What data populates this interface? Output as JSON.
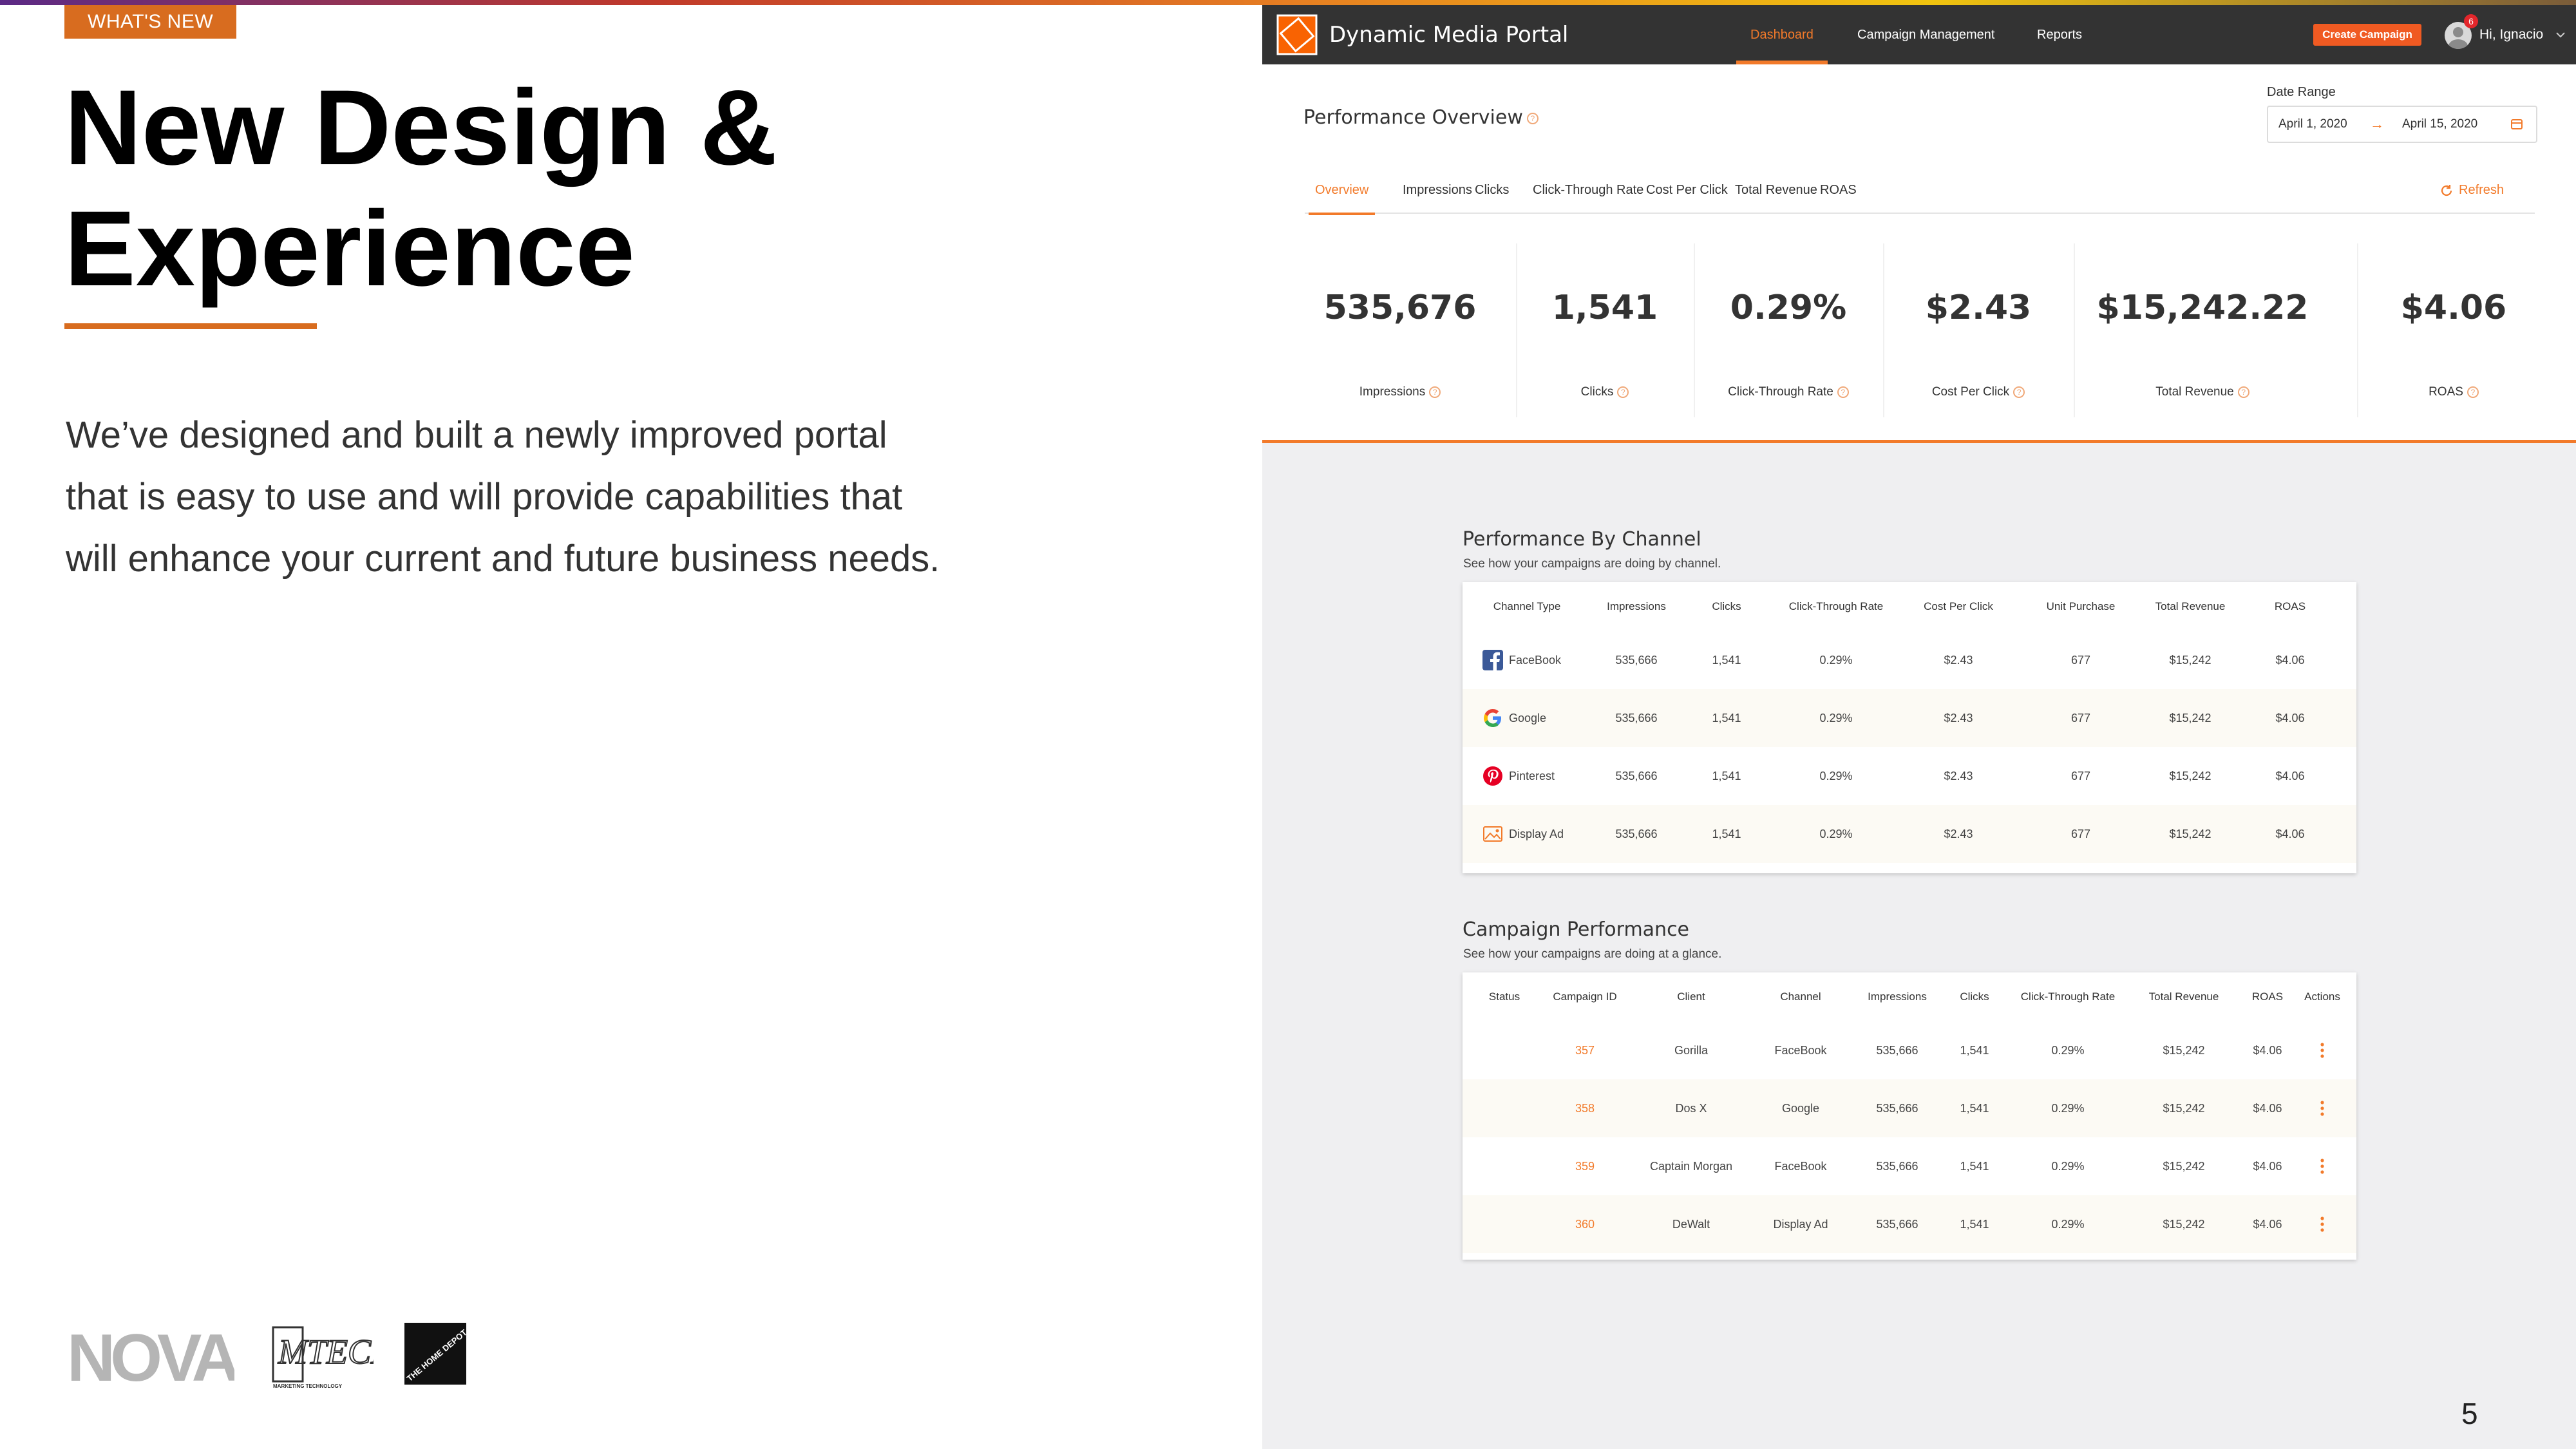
{
  "slide": {
    "tag": "WHAT'S NEW",
    "title_line1": "New Design &",
    "title_line2": "Experience",
    "body_line1": "We’ve designed and built a newly improved portal",
    "body_line2": "that is easy to use and will provide capabilities that",
    "body_line3": "will enhance your current and future business needs.",
    "page_number": "5"
  },
  "navbar": {
    "app_title": "Dynamic Media Portal",
    "links": [
      "Dashboard",
      "Campaign Management",
      "Reports"
    ],
    "active_link": "Dashboard",
    "create_label": "Create Campaign",
    "notification_count": "6",
    "greeting": "Hi, Ignacio"
  },
  "overview": {
    "title": "Performance Overview",
    "date_label": "Date Range",
    "date_start": "April 1, 2020",
    "date_arrow": "→",
    "date_end": "April 15, 2020",
    "tabs": [
      "Overview",
      "Impressions",
      "Clicks",
      "Click-Through Rate",
      "Cost Per Click",
      "Total Revenue",
      "ROAS"
    ],
    "refresh_label": "Refresh",
    "metrics": [
      {
        "value": "535,676",
        "label": "Impressions"
      },
      {
        "value": "1,541",
        "label": "Clicks"
      },
      {
        "value": "0.29%",
        "label": "Click-Through Rate"
      },
      {
        "value": "$2.43",
        "label": "Cost Per Click"
      },
      {
        "value": "$15,242.22",
        "label": "Total Revenue"
      },
      {
        "value": "$4.06",
        "label": "ROAS"
      }
    ]
  },
  "channels": {
    "title": "Performance By Channel",
    "subtitle": "See how your campaigns are doing by channel.",
    "headers": [
      "Channel Type",
      "Impressions",
      "Clicks",
      "Click-Through Rate",
      "Cost Per Click",
      "Unit Purchase",
      "Total Revenue",
      "ROAS"
    ],
    "rows": [
      {
        "channel": "FaceBook",
        "icon": "facebook-icon",
        "impressions": "535,666",
        "clicks": "1,541",
        "ctr": "0.29%",
        "cpc": "$2.43",
        "units": "677",
        "revenue": "$15,242",
        "roas": "$4.06"
      },
      {
        "channel": "Google",
        "icon": "google-icon",
        "impressions": "535,666",
        "clicks": "1,541",
        "ctr": "0.29%",
        "cpc": "$2.43",
        "units": "677",
        "revenue": "$15,242",
        "roas": "$4.06"
      },
      {
        "channel": "Pinterest",
        "icon": "pinterest-icon",
        "impressions": "535,666",
        "clicks": "1,541",
        "ctr": "0.29%",
        "cpc": "$2.43",
        "units": "677",
        "revenue": "$15,242",
        "roas": "$4.06"
      },
      {
        "channel": "Display Ad",
        "icon": "image-icon",
        "impressions": "535,666",
        "clicks": "1,541",
        "ctr": "0.29%",
        "cpc": "$2.43",
        "units": "677",
        "revenue": "$15,242",
        "roas": "$4.06"
      }
    ]
  },
  "campaigns": {
    "title": "Campaign Performance",
    "subtitle": "See how your campaigns are doing at a glance.",
    "headers": [
      "Status",
      "Campaign ID",
      "Client",
      "Channel",
      "Impressions",
      "Clicks",
      "Click-Through Rate",
      "Total Revenue",
      "ROAS",
      "Actions"
    ],
    "rows": [
      {
        "id": "357",
        "client": "Gorilla",
        "channel": "FaceBook",
        "impressions": "535,666",
        "clicks": "1,541",
        "ctr": "0.29%",
        "revenue": "$15,242",
        "roas": "$4.06"
      },
      {
        "id": "358",
        "client": "Dos X",
        "channel": "Google",
        "impressions": "535,666",
        "clicks": "1,541",
        "ctr": "0.29%",
        "revenue": "$15,242",
        "roas": "$4.06"
      },
      {
        "id": "359",
        "client": "Captain Morgan",
        "channel": "FaceBook",
        "impressions": "535,666",
        "clicks": "1,541",
        "ctr": "0.29%",
        "revenue": "$15,242",
        "roas": "$4.06"
      },
      {
        "id": "360",
        "client": "DeWalt",
        "channel": "Display Ad",
        "impressions": "535,666",
        "clicks": "1,541",
        "ctr": "0.29%",
        "revenue": "$15,242",
        "roas": "$4.06"
      }
    ]
  },
  "logos": {
    "nova": "NOVA",
    "mtech": "MTECH",
    "mtech_sub": "MARKETING TECHNOLOGY",
    "thd": "THE HOME DEPOT"
  },
  "colors": {
    "accent": "#f27a2a",
    "tag": "#d86c1f",
    "navbar": "#333333",
    "button": "#f05a22"
  }
}
